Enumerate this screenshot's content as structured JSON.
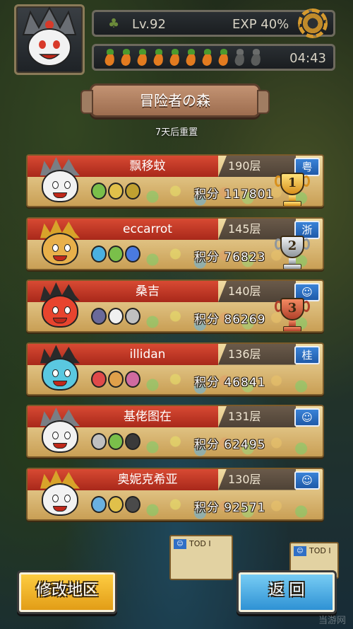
{
  "hud": {
    "level": "Lv.92",
    "exp": "EXP 40%",
    "timer": "04:43",
    "carrots_full": 8,
    "carrots_total": 10
  },
  "header": {
    "title": "冒险者の森",
    "reset_note": "7天后重置"
  },
  "rankings": [
    {
      "name": "飘移蚊",
      "floor": "190层",
      "score": "积分 117801",
      "region": "粤",
      "trophy": "gold",
      "trophy_num": "1"
    },
    {
      "name": "eccarrot",
      "floor": "145层",
      "score": "积分 76823",
      "region": "浙",
      "trophy": "silver",
      "trophy_num": "2"
    },
    {
      "name": "桑吉",
      "floor": "140层",
      "score": "积分 86269",
      "region": "☺",
      "trophy": "bronze",
      "trophy_num": "3"
    },
    {
      "name": "illidan",
      "floor": "136层",
      "score": "积分 46841",
      "region": "桂",
      "trophy": "",
      "trophy_num": ""
    },
    {
      "name": "基佬图在",
      "floor": "131层",
      "score": "积分 62495",
      "region": "☺",
      "trophy": "",
      "trophy_num": ""
    },
    {
      "name": "奥妮克希亚",
      "floor": "130层",
      "score": "积分 92571",
      "region": "☺",
      "trophy": "",
      "trophy_num": ""
    }
  ],
  "map": {
    "tile_label": "TOD I",
    "tile_label_2": "TOD I",
    "tile_badge": "☺"
  },
  "buttons": {
    "change_region": "修改地区",
    "back": "返 回"
  },
  "watermark": "当游网",
  "colors": {
    "name_band": "#c83a26",
    "region_badge": "#2f6fc6",
    "left_button": "#f0b22a",
    "right_button": "#4fb2e6"
  }
}
